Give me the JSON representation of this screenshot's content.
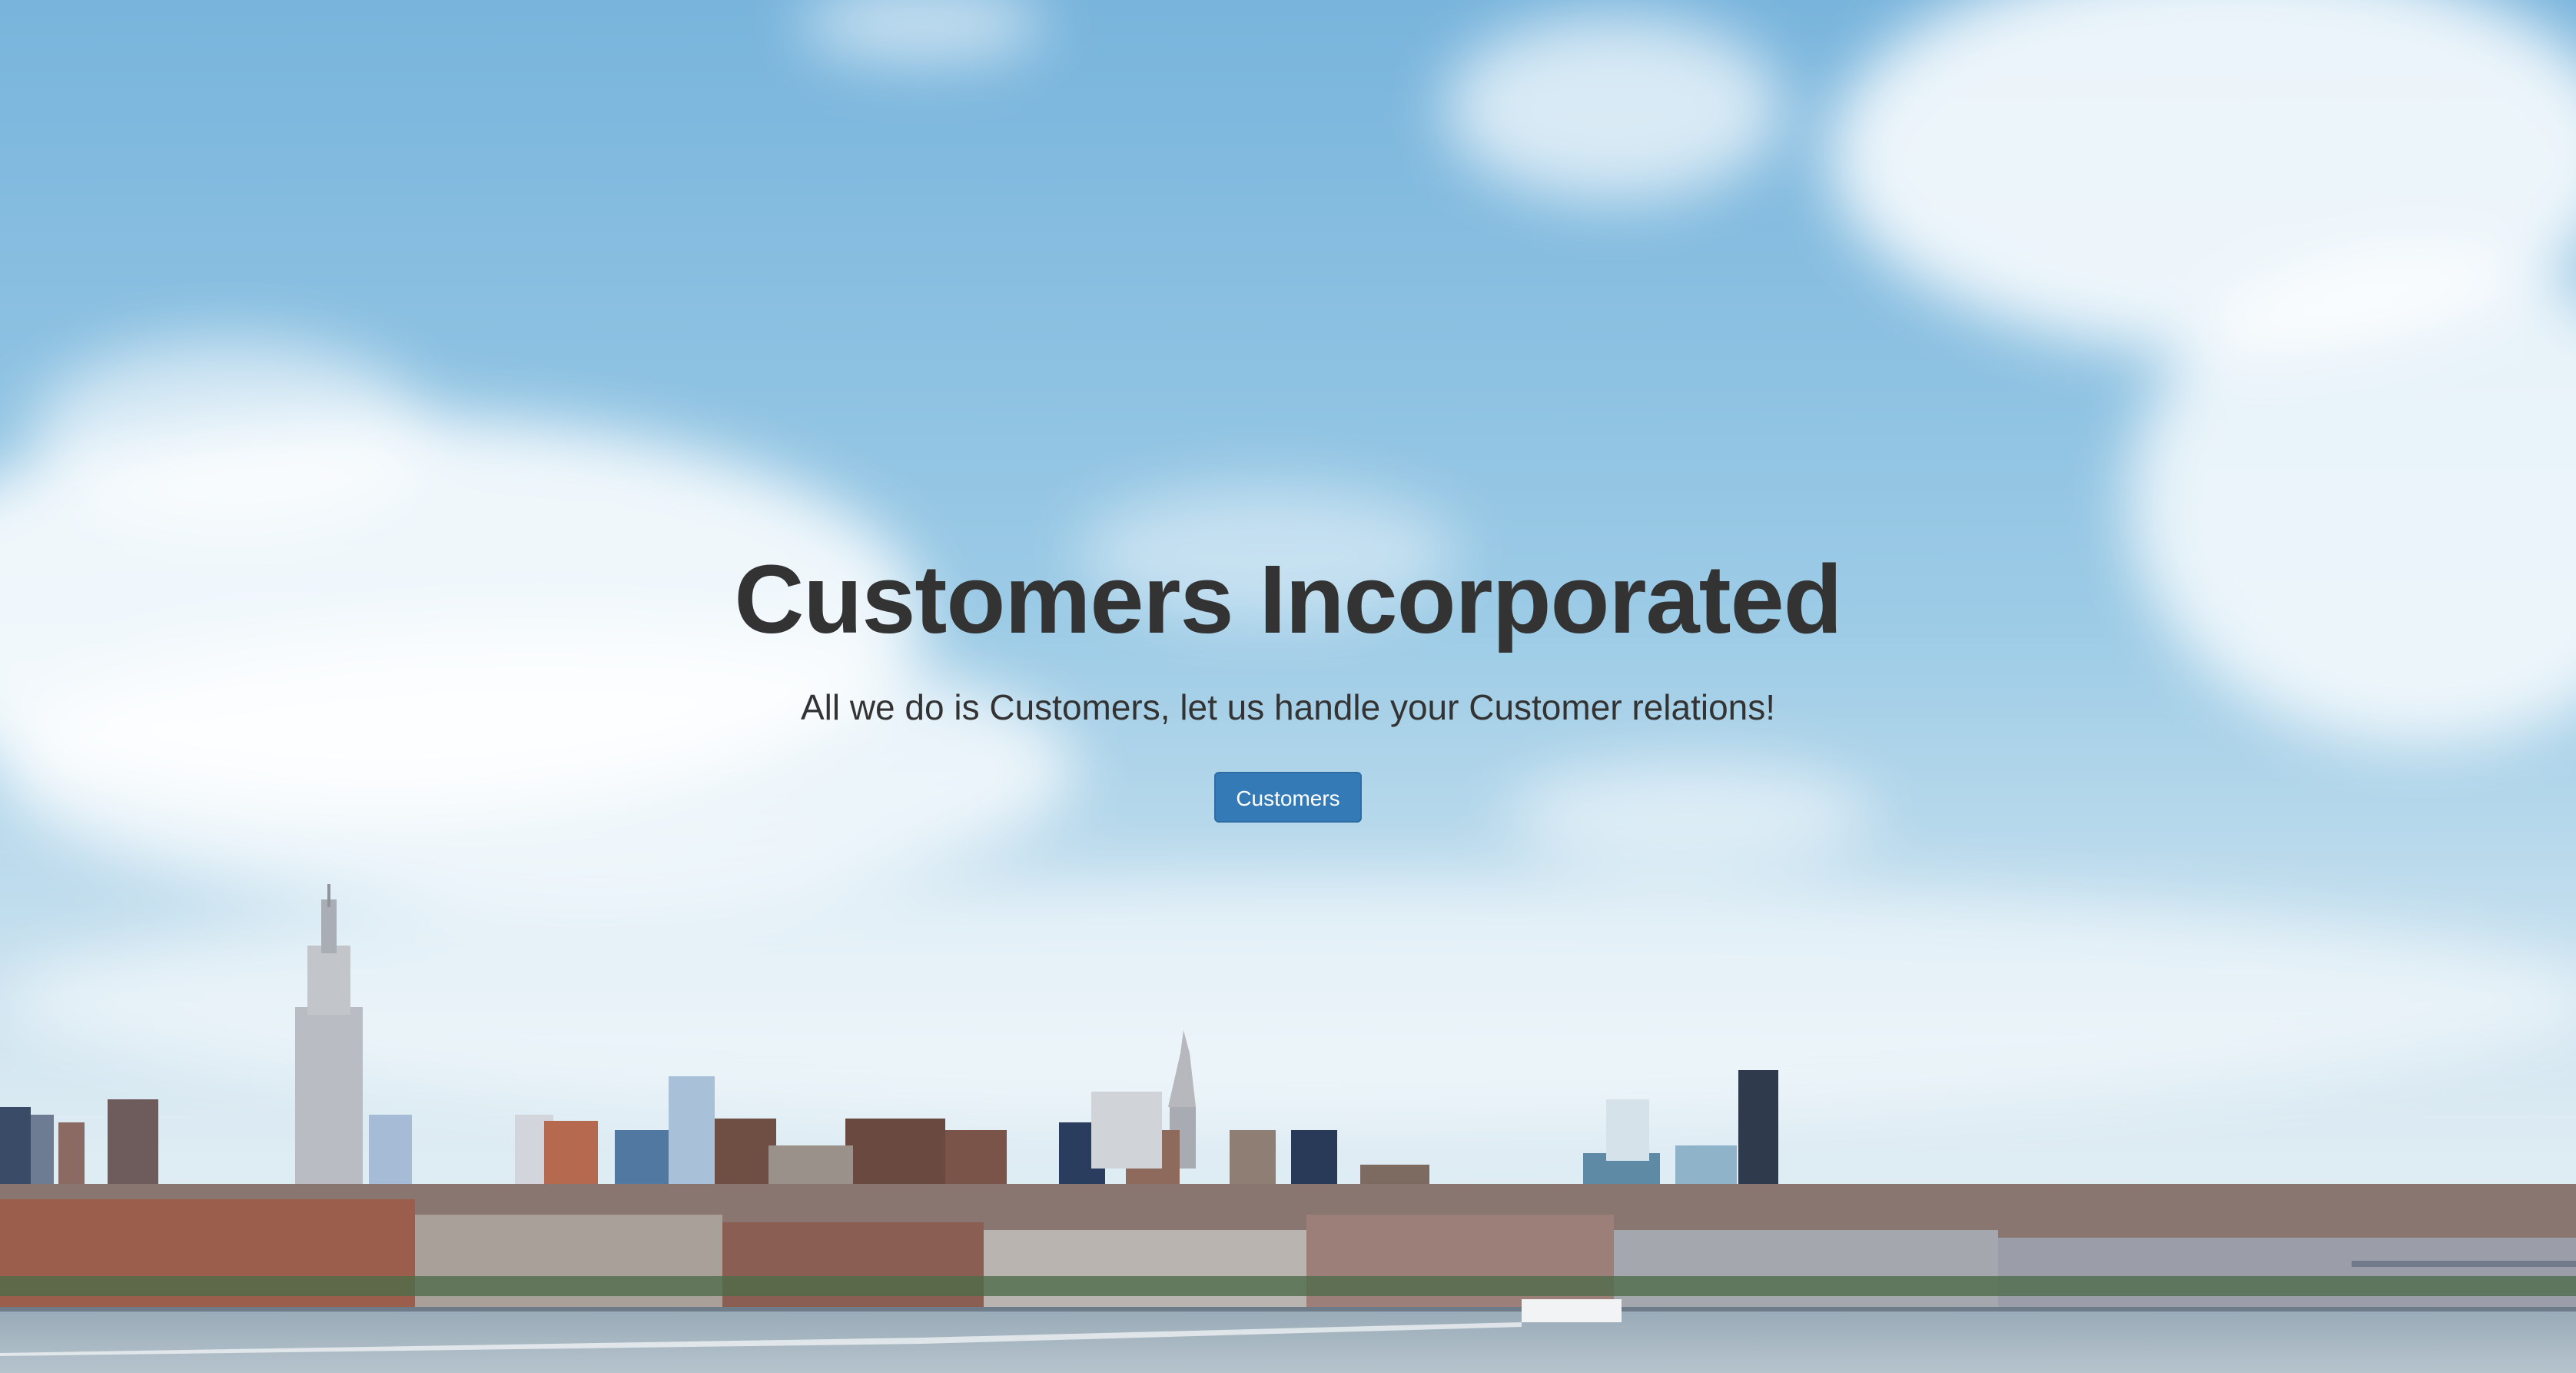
{
  "hero": {
    "title": "Customers Incorporated",
    "subtitle": "All we do is Customers, let us handle your Customer relations!",
    "button_label": "Customers",
    "background_image": "city-skyline-over-water",
    "colors": {
      "sky_top": "#78b4dc",
      "sky_horizon": "#dcebf3",
      "water": "#a9b9c4",
      "text": "#333333",
      "button_bg": "#337ab7",
      "button_text": "#ffffff"
    }
  }
}
